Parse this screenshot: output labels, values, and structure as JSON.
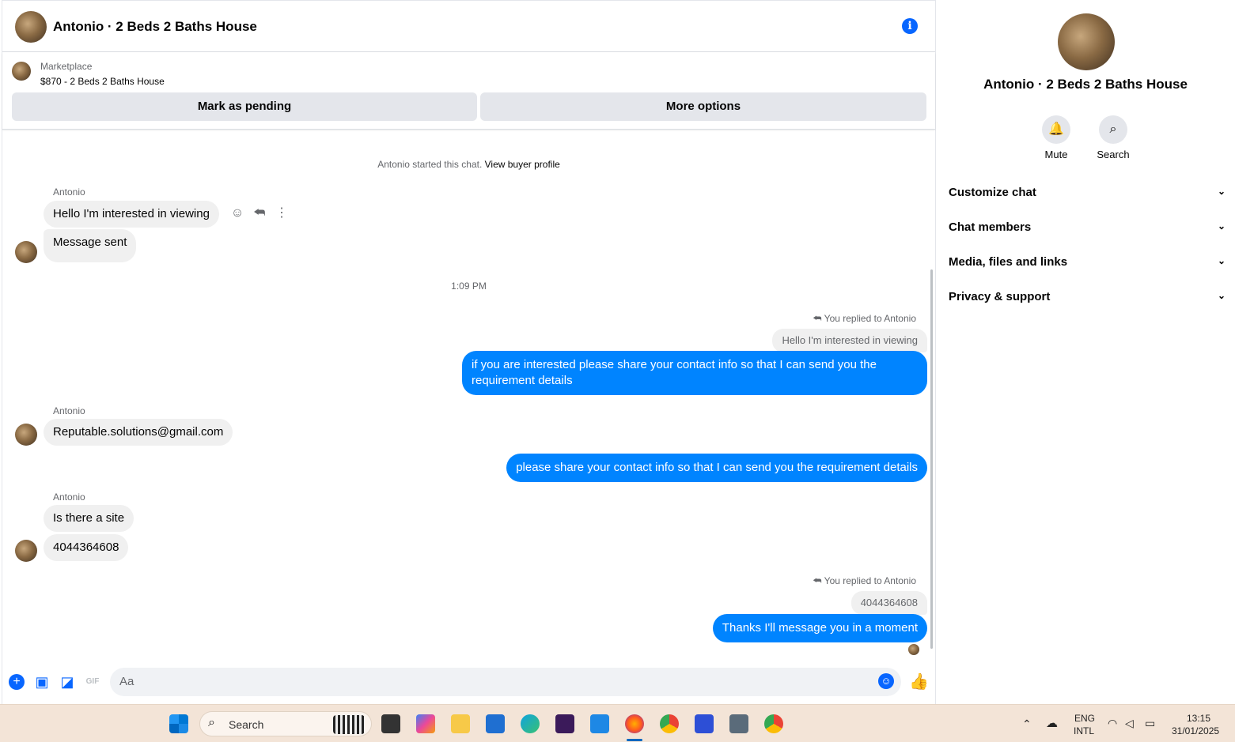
{
  "header": {
    "title": "Antonio · 2 Beds 2 Baths House"
  },
  "marketplace": {
    "label": "Marketplace",
    "listing": "$870 - 2 Beds 2 Baths House",
    "mark_pending": "Mark as pending",
    "more_options": "More options"
  },
  "chat": {
    "started_note": "Antonio started this chat.",
    "view_profile": "View buyer profile",
    "timestamp": "1:09 PM",
    "sender_name": "Antonio",
    "msg1": "Hello I'm interested in viewing",
    "msg2": "Message sent",
    "replied_label": "You replied to Antonio",
    "quote1": "Hello I'm interested in viewing",
    "out1": "if you are interested please share your contact info so that I can send you the requirement details",
    "msg3": "Reputable.solutions@gmail.com",
    "out2": "please share your contact info so that I can send you the requirement details",
    "msg4": "Is there a site",
    "msg5": "4044364608",
    "quote2": "4044364608",
    "out3": "Thanks I'll message you in a moment"
  },
  "composer": {
    "placeholder": "Aa"
  },
  "sidebar": {
    "title": "Antonio · 2 Beds 2 Baths House",
    "mute": "Mute",
    "search": "Search",
    "items": [
      "Customize chat",
      "Chat members",
      "Media, files and links",
      "Privacy & support"
    ]
  },
  "taskbar": {
    "search": "Search",
    "lang1": "ENG",
    "lang2": "INTL",
    "time": "13:15",
    "date": "31/01/2025"
  },
  "colors": {
    "accent": "#0866ff",
    "out_bubble": "#0084ff",
    "in_bubble": "#f0f0f0"
  }
}
